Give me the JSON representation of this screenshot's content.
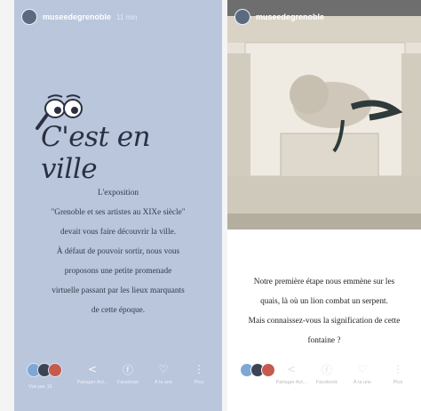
{
  "left_story": {
    "account": "museedegrenoble",
    "time": "11 min",
    "title": "C'est en ville",
    "body_lines": [
      "L'exposition",
      "\"Grenoble et ses artistes au XIXe siècle\"",
      "devait vous faire découvrir la ville.",
      "À défaut de pouvoir sortir, nous vous",
      "proposons une petite promenade",
      "virtuelle passant par les lieux marquants",
      "de cette époque."
    ],
    "seen_label": "Vue par 16",
    "actions": [
      {
        "icon": "share-icon",
        "label": "Partager\nAct..."
      },
      {
        "icon": "facebook-icon",
        "label": "Facebook"
      },
      {
        "icon": "add-icon",
        "label": "À la une"
      },
      {
        "icon": "more-icon",
        "label": "Plus"
      }
    ]
  },
  "right_story": {
    "account": "museedegrenoble",
    "body_lines": [
      "Notre première étape nous emmène sur les",
      "quais, là où un lion combat un serpent.",
      "Mais connaissez-vous la signification de cette",
      "fontaine ?"
    ],
    "actions": [
      {
        "icon": "share-icon",
        "label": "Partager\nAct..."
      },
      {
        "icon": "facebook-icon",
        "label": "Facebook"
      },
      {
        "icon": "add-icon",
        "label": "À la une"
      },
      {
        "icon": "more-icon",
        "label": "Plus"
      }
    ]
  },
  "colors": {
    "left_bg": "#b9c6dc",
    "ink": "#2a3042"
  }
}
